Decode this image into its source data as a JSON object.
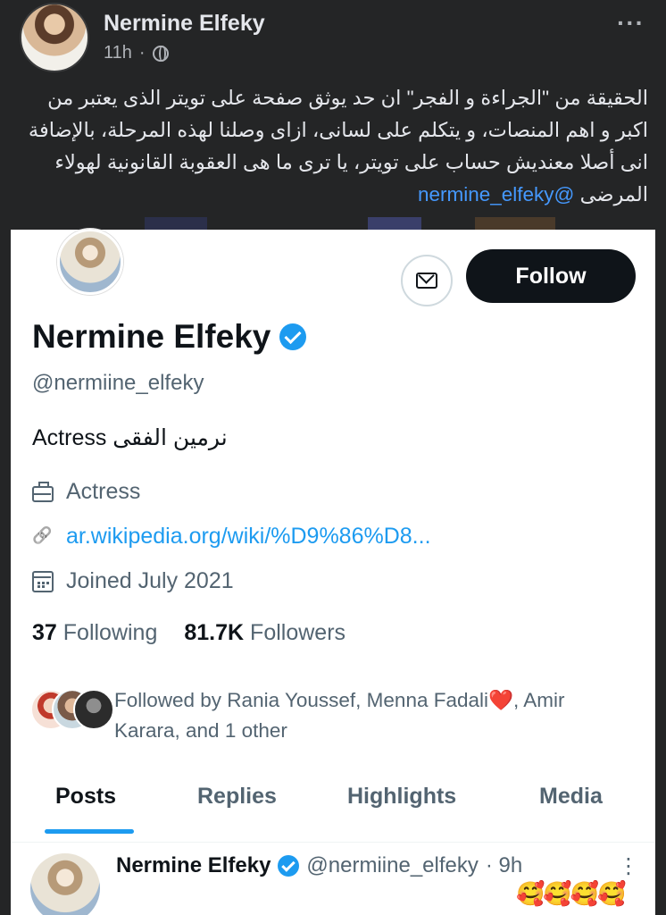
{
  "fb_post": {
    "author": "Nermine Elfeky",
    "time": "11h",
    "separator": "·",
    "privacy_icon": "globe-icon",
    "more_icon": "more-dots-icon",
    "caption": "الحقيقة من \"الجراءة و الفجر\" ان حد يوثق صفحة على تويتر الذى يعتبر من اكبر و اهم المنصات، و يتكلم على لسانى، ازاى وصلنا لهذه المرحلة، بالإضافة انى أصلا معنديش حساب على تويتر، يا ترى ما هى العقوبة القانونية لهولاء المرضى ",
    "mention": "@nermine_elfeky"
  },
  "twitter_profile": {
    "follow_label": "Follow",
    "message_icon": "mail-icon",
    "name": "Nermine Elfeky",
    "handle": "@nermiine_elfeky",
    "bio": "Actress نرمين الفقى",
    "category": "Actress",
    "link": "ar.wikipedia.org/wiki/%D9%86%D8...",
    "joined": "Joined July 2021",
    "following_count": "37",
    "following_label": "Following",
    "followers_count": "81.7K",
    "followers_label": "Followers",
    "followed_by_prefix": "Followed by Rania Youssef, Menna Fadali",
    "followed_by_heart": "❤️",
    "followed_by_suffix": ", Amir Karara, and 1 other",
    "accent_color": "#1d9bf0"
  },
  "tabs": [
    "Posts",
    "Replies",
    "Highlights",
    "Media"
  ],
  "post": {
    "name": "Nermine Elfeky",
    "handle": "@nermiine_elfeky",
    "time": "· 9h",
    "more": "⋮",
    "emojis": "🥰🥰🥰🥰"
  }
}
